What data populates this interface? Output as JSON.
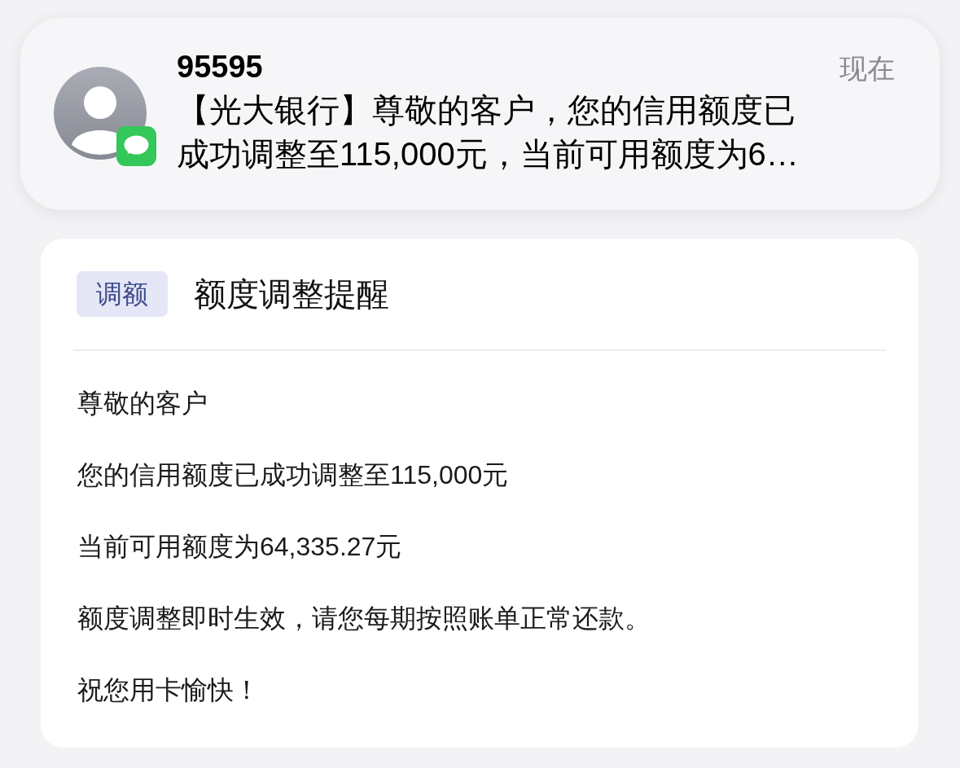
{
  "notification": {
    "sender": "95595",
    "time": "现在",
    "message_lines": [
      "【光大银行】尊敬的客户，您的信用额度已",
      "成功调整至115,000元，当前可用额度为6…"
    ]
  },
  "card": {
    "tag": "调额",
    "title": "额度调整提醒",
    "paragraphs": [
      "尊敬的客户",
      "您的信用额度已成功调整至115,000元",
      "当前可用额度为64,335.27元",
      "额度调整即时生效，请您每期按照账单正常还款。",
      "祝您用卡愉快！"
    ]
  }
}
